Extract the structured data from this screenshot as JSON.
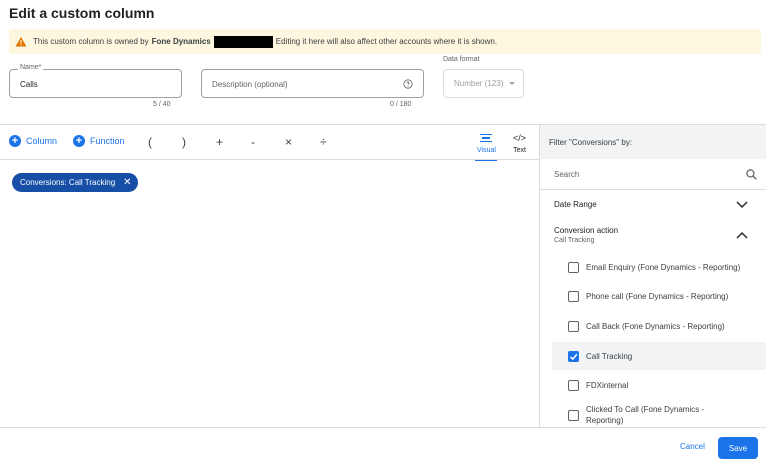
{
  "dialog": {
    "title": "Edit a custom column"
  },
  "warning": {
    "text_before": "This custom column is owned by",
    "owner": "Fone Dynamics",
    "text_after": "Editing it here will also affect other accounts where it is shown."
  },
  "name_field": {
    "label": "Name*",
    "value": "Calls",
    "counter": "5 / 40"
  },
  "description_field": {
    "placeholder": "Description (optional)",
    "counter": "0 / 180"
  },
  "data_format": {
    "label": "Data format",
    "value": "Number (123)"
  },
  "toolbar": {
    "column_label": "Column",
    "function_label": "Function",
    "operators": [
      "(",
      ")",
      "+",
      "-",
      "×",
      "÷"
    ],
    "visual_label": "Visual",
    "text_label": "Text"
  },
  "formula": {
    "chip_label": "Conversions: Call Tracking"
  },
  "filter": {
    "header": "Filter \"Conversions\" by:",
    "search_placeholder": "Search",
    "date_range_label": "Date Range",
    "conversion_action_label": "Conversion action",
    "conversion_action_sub": "Call Tracking",
    "options": [
      {
        "label": "Email Enquiry (Fone Dynamics - Reporting)",
        "checked": false
      },
      {
        "label": "Phone call (Fone Dynamics - Reporting)",
        "checked": false
      },
      {
        "label": "Call Back (Fone Dynamics - Reporting)",
        "checked": false
      },
      {
        "label": "Call Tracking",
        "checked": true
      },
      {
        "label": "FDXinternal",
        "checked": false
      },
      {
        "label": "Clicked To Call (Fone Dynamics - Reporting)",
        "checked": false
      }
    ]
  },
  "footer": {
    "cancel_label": "Cancel",
    "save_label": "Save"
  },
  "colors": {
    "accent": "#1a73e8",
    "chip": "#174ea6",
    "warning_bg": "#fef7e0",
    "warning_icon": "#e37400"
  }
}
